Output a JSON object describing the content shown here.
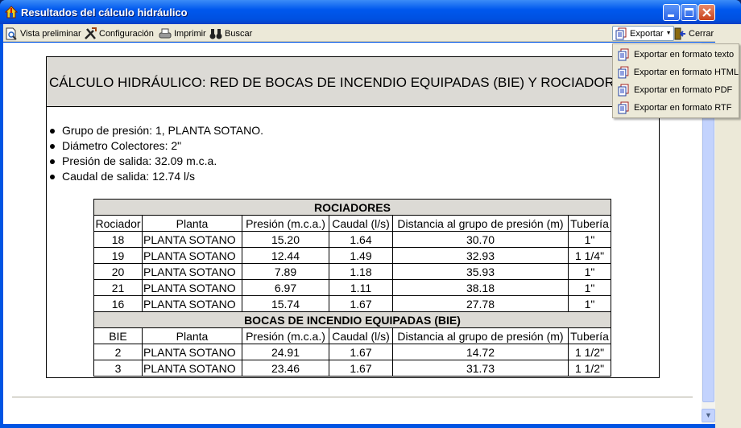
{
  "window": {
    "title": "Resultados del cálculo hidráulico"
  },
  "toolbar": {
    "preview": "Vista preliminar",
    "config": "Configuración",
    "print": "Imprimir",
    "search": "Buscar",
    "export": "Exportar",
    "close": "Cerrar"
  },
  "export_menu": [
    "Exportar en formato texto",
    "Exportar en formato HTML",
    "Exportar en formato PDF",
    "Exportar en formato RTF"
  ],
  "report": {
    "title": "CÁLCULO HIDRÁULICO: RED DE BOCAS DE INCENDIO EQUIPADAS (BIE) Y ROCIADORES",
    "bullets": [
      "Grupo de presión: 1, PLANTA SOTANO.",
      "Diámetro Colectores: 2\"",
      "Presión de salida: 32.09 m.c.a.",
      "Caudal de salida: 12.74 l/s"
    ],
    "sprinklers": {
      "title": "ROCIADORES",
      "headers": [
        "Rociador",
        "Planta",
        "Presión (m.c.a.)",
        "Caudal (l/s)",
        "Distancia al grupo de presión (m)",
        "Tubería"
      ],
      "rows": [
        [
          "18",
          "PLANTA SOTANO",
          "15.20",
          "1.64",
          "30.70",
          "1\""
        ],
        [
          "19",
          "PLANTA SOTANO",
          "12.44",
          "1.49",
          "32.93",
          "1 1/4\""
        ],
        [
          "20",
          "PLANTA SOTANO",
          "7.89",
          "1.18",
          "35.93",
          "1\""
        ],
        [
          "21",
          "PLANTA SOTANO",
          "6.97",
          "1.11",
          "38.18",
          "1\""
        ],
        [
          "16",
          "PLANTA SOTANO",
          "15.74",
          "1.67",
          "27.78",
          "1\""
        ]
      ]
    },
    "bie": {
      "title": "BOCAS DE INCENDIO EQUIPADAS (BIE)",
      "headers": [
        "BIE",
        "Planta",
        "Presión (m.c.a.)",
        "Caudal (l/s)",
        "Distancia al grupo de presión (m)",
        "Tubería"
      ],
      "rows": [
        [
          "2",
          "PLANTA SOTANO",
          "24.91",
          "1.67",
          "14.72",
          "1 1/2\""
        ],
        [
          "3",
          "PLANTA SOTANO",
          "23.46",
          "1.67",
          "31.73",
          "1 1/2\""
        ]
      ]
    }
  }
}
